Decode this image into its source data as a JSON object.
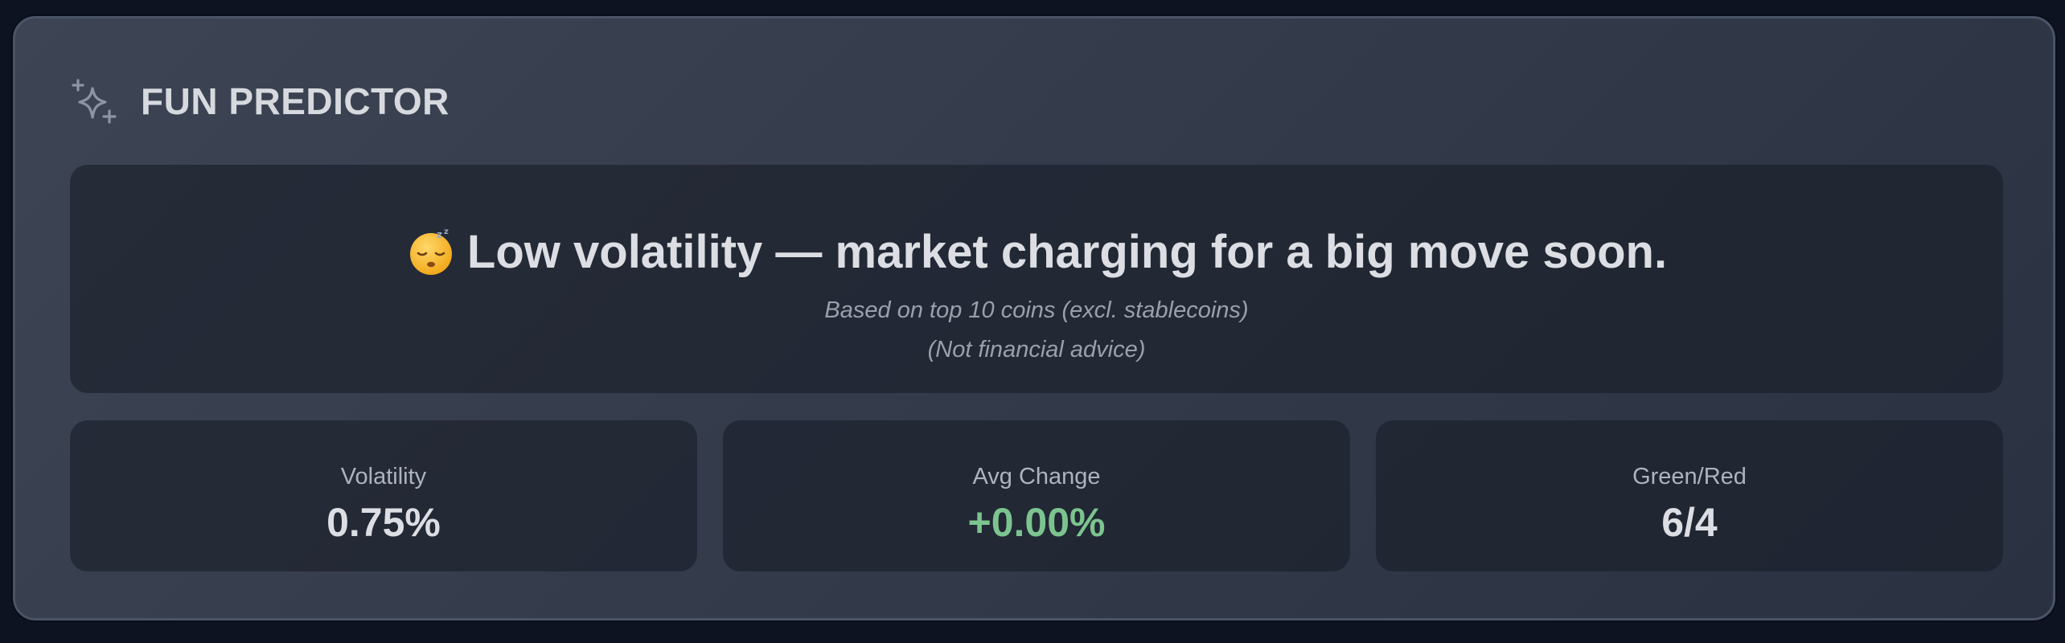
{
  "widget": {
    "title": "FUN PREDICTOR",
    "icon": "sparkles-icon"
  },
  "prediction": {
    "emoji_icon": "sleeping-face-icon",
    "headline": "Low volatility — market charging for a big move soon.",
    "note_basis": "Based on top 10 coins (excl. stablecoins)",
    "note_disclaimer": "(Not financial advice)"
  },
  "stats": [
    {
      "label": "Volatility",
      "value": "0.75%"
    },
    {
      "label": "Avg Change",
      "value": "+0.00%",
      "color": "#7cc48f"
    },
    {
      "label": "Green/Red",
      "value": "6/4"
    }
  ],
  "colors": {
    "background": "#0e1322",
    "text": "#dcdee3",
    "muted_text": "#9aa1ad",
    "positive": "#7cc48f"
  }
}
